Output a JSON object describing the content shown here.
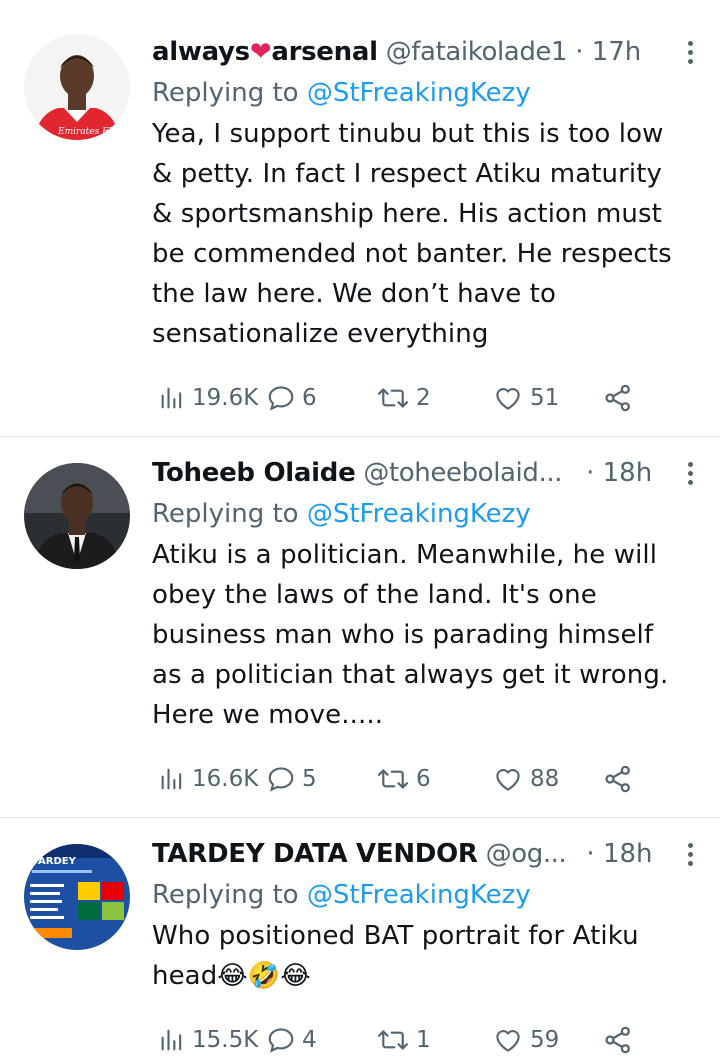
{
  "tweets": [
    {
      "name": "always",
      "name_suffix": "arsenal",
      "handle": "@fataikolade1",
      "time": "· 17h",
      "replying_prefix": "Replying to",
      "replying_to": "@StFreakingKezy",
      "text": "Yea, I support tinubu but this is too low\n& petty. In fact I respect Atiku maturity\n& sportsmanship here. His action must\nbe commended not banter. He respects\nthe law here. We don’t have to\nsensationalize everything",
      "views": "19.6K",
      "replies": "6",
      "retweets": "2",
      "likes": "51",
      "avatar_text": "Emirates FLY BETTER"
    },
    {
      "name": "Toheeb Olaide",
      "handle": "@toheebolaid...",
      "time": "· 18h",
      "replying_prefix": "Replying to",
      "replying_to": "@StFreakingKezy",
      "text": "Atiku is a politician. Meanwhile, he will\nobey the laws of the land. It's one\nbusiness man who is parading himself\nas a politician that always get it wrong.\nHere we move.....",
      "views": "16.6K",
      "replies": "5",
      "retweets": "6",
      "likes": "88"
    },
    {
      "name": "TARDEY DATA VENDOR",
      "handle": "@og...",
      "time": "· 18h",
      "replying_prefix": "Replying to",
      "replying_to": "@StFreakingKezy",
      "text": "Who positioned BAT portrait for Atiku\nhead😂🤣😂",
      "views": "15.5K",
      "replies": "4",
      "retweets": "1",
      "likes": "59",
      "avatar_text": "TARDEY"
    }
  ]
}
